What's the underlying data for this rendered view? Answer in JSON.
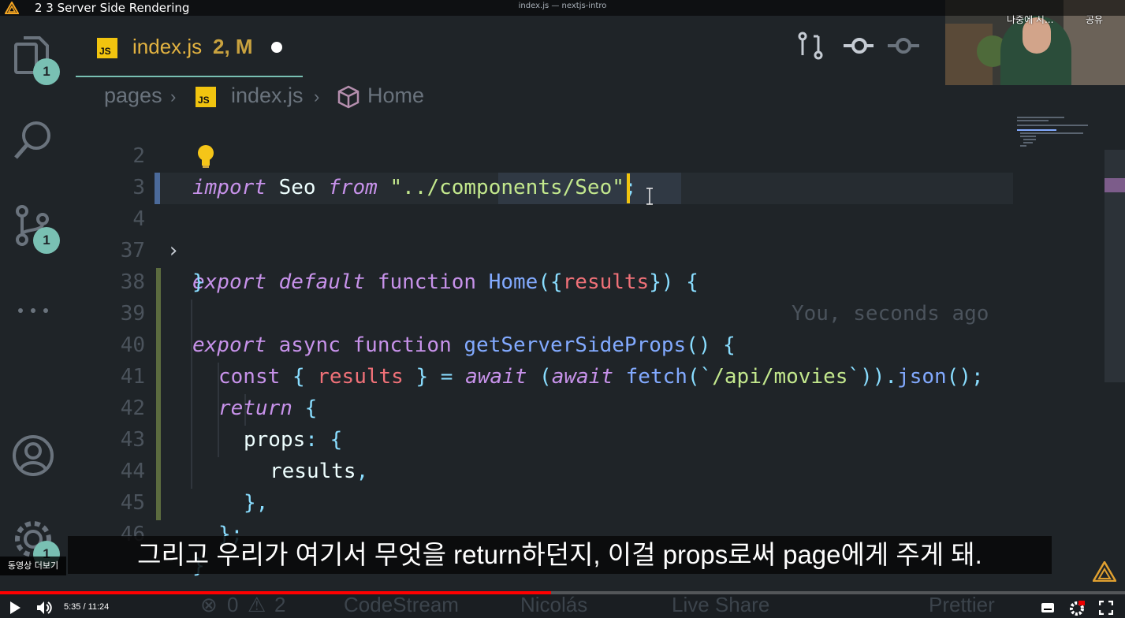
{
  "video": {
    "title": "2 3 Server Side Rendering",
    "window_title": "index.js — nextjs-intro",
    "time": "5:35 / 11:24",
    "progress_fraction": 0.49,
    "more_videos": "동영상 더보기",
    "watch_later": "나중에 시...",
    "share": "공유"
  },
  "activity_bar": {
    "explorer_badge": "1",
    "scm_badge": "1",
    "settings_badge": "1"
  },
  "tab": {
    "icon_text": "JS",
    "name": "index.js",
    "status": "2, M"
  },
  "breadcrumb": {
    "folder": "pages",
    "file": "index.js",
    "symbol": "Home"
  },
  "code_lines": [
    {
      "num": "2"
    },
    {
      "num": "3"
    },
    {
      "num": "4"
    },
    {
      "num": "37"
    },
    {
      "num": "38"
    },
    {
      "num": "39"
    },
    {
      "num": "40"
    },
    {
      "num": "41"
    },
    {
      "num": "42"
    },
    {
      "num": "43"
    },
    {
      "num": "44"
    },
    {
      "num": "45"
    },
    {
      "num": "46"
    }
  ],
  "code": {
    "l2": {
      "a": "import",
      "b": " Seo ",
      "c": "from",
      "d": " \"../components/Seo\"",
      "e": ";"
    },
    "l4": {
      "a": "export",
      "b": "default",
      "c": "function",
      "d": "Home",
      "e": "({",
      "f": "results",
      "g": "})",
      "h": "{",
      "blame": "You, seconds ago"
    },
    "l37": "}",
    "l39": {
      "a": "export",
      "b": "async",
      "c": "function",
      "d": "getServerSideProps",
      "e": "()",
      "f": "{"
    },
    "l40": {
      "a": "const",
      "b": "{",
      "c": "results",
      "d": "}",
      "e": "=",
      "f": "await",
      "g": "(",
      "h": "await",
      "i": "fetch",
      "j": "(`",
      "k": "/api/movies",
      "l": "`))",
      "m": ".",
      "n": "json",
      "o": "();"
    },
    "l41": {
      "a": "return",
      "b": "{"
    },
    "l42": {
      "a": "props",
      "b": ":",
      "c": "{"
    },
    "l43": {
      "a": "results",
      "b": ","
    },
    "l44": "},",
    "l45": "};",
    "l46": "}"
  },
  "subtitle": "그리고 우리가 여기서 무엇을 return하던지, 이걸 props로써 page에게 주게 돼.",
  "statusbar": {
    "errors": "0",
    "warnings": "2",
    "codestream": "CodeStream",
    "user": "Nicolás",
    "liveshare": "Live Share",
    "prettier": "Prettier"
  },
  "colors": {
    "accent": "#79c0b3",
    "keyword": "#c792ea",
    "function": "#82aaff",
    "string": "#c3e88d",
    "variable": "#f07178"
  }
}
